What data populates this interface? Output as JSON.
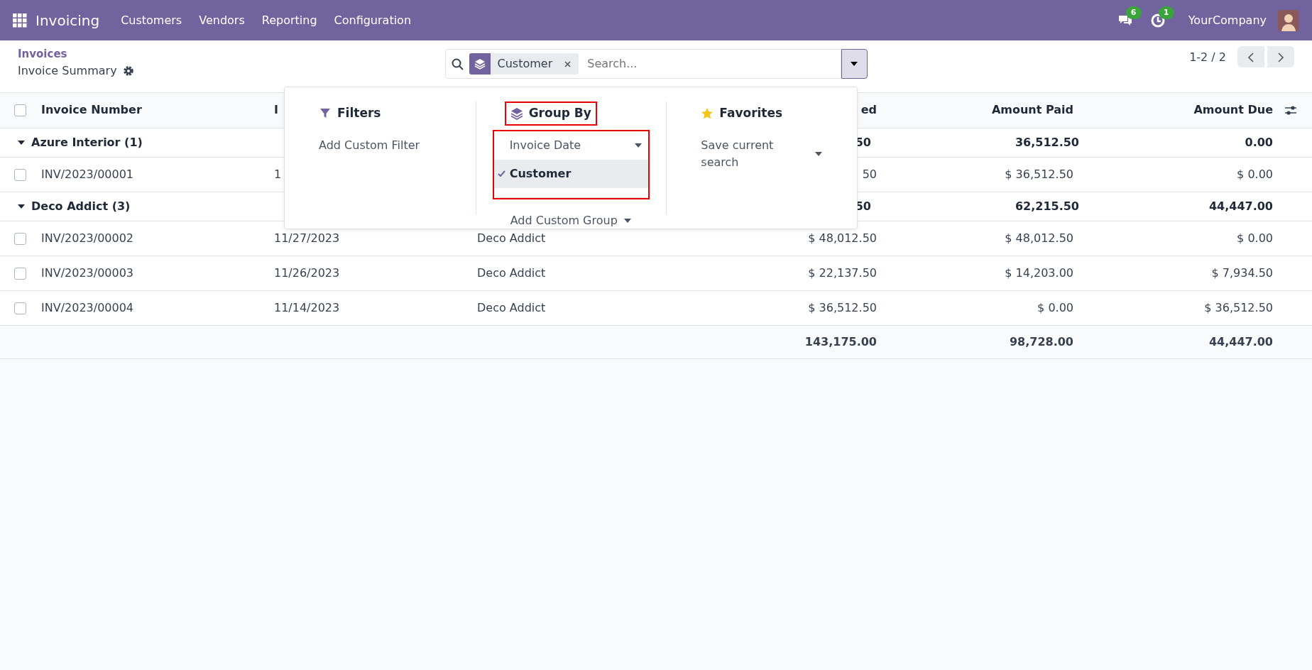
{
  "navbar": {
    "app": "Invoicing",
    "menu": [
      "Customers",
      "Vendors",
      "Reporting",
      "Configuration"
    ],
    "messages_count": "6",
    "activities_count": "1",
    "company": "YourCompany"
  },
  "breadcrumb": {
    "parent": "Invoices",
    "current": "Invoice Summary"
  },
  "search": {
    "facet": "Customer",
    "placeholder": "Search..."
  },
  "pager": "1-2 / 2",
  "search_panel": {
    "filters": {
      "title": "Filters",
      "items": [
        "Add Custom Filter"
      ]
    },
    "group_by": {
      "title": "Group By",
      "title_highlighted": true,
      "options_highlighted": true,
      "options": [
        {
          "label": "Invoice Date",
          "kind": "date",
          "selected": false
        },
        {
          "label": "Customer",
          "kind": "field",
          "selected": true
        }
      ],
      "custom": "Add Custom Group"
    },
    "favorites": {
      "title": "Favorites",
      "items": [
        "Save current search"
      ]
    }
  },
  "table": {
    "select_all_checked": false,
    "columns": [
      {
        "label": "Invoice Number",
        "kind": "text"
      },
      {
        "label": "I",
        "kind": "text"
      },
      {
        "kind": "text"
      },
      {
        "label": "ed",
        "kind": "amount"
      },
      {
        "label": "Amount Paid",
        "kind": "amount"
      },
      {
        "label": "Amount Due",
        "kind": "amount"
      }
    ],
    "groups": [
      {
        "label": "Azure Interior (1)",
        "expanded": true,
        "cells": [
          null,
          null,
          "50",
          "36,512.50",
          "0.00"
        ],
        "rows": [
          {
            "checked": false,
            "cells": [
              "INV/2023/00001",
              "1",
              null,
              "50",
              "$ 36,512.50",
              "$ 0.00"
            ]
          }
        ]
      },
      {
        "label": "Deco Addict (3)",
        "expanded": true,
        "cells": [
          null,
          null,
          "50",
          "62,215.50",
          "44,447.00"
        ],
        "rows": [
          {
            "checked": false,
            "cells": [
              "INV/2023/00002",
              "11/27/2023",
              "Deco Addict",
              "$ 48,012.50",
              "$ 48,012.50",
              "$ 0.00"
            ]
          },
          {
            "checked": false,
            "cells": [
              "INV/2023/00003",
              "11/26/2023",
              "Deco Addict",
              "$ 22,137.50",
              "$ 14,203.00",
              "$ 7,934.50"
            ]
          },
          {
            "checked": false,
            "cells": [
              "INV/2023/00004",
              "11/14/2023",
              "Deco Addict",
              "$ 36,512.50",
              "$ 0.00",
              "$ 36,512.50"
            ]
          }
        ]
      }
    ],
    "totals": [
      "143,175.00",
      "98,728.00",
      "44,447.00"
    ]
  }
}
